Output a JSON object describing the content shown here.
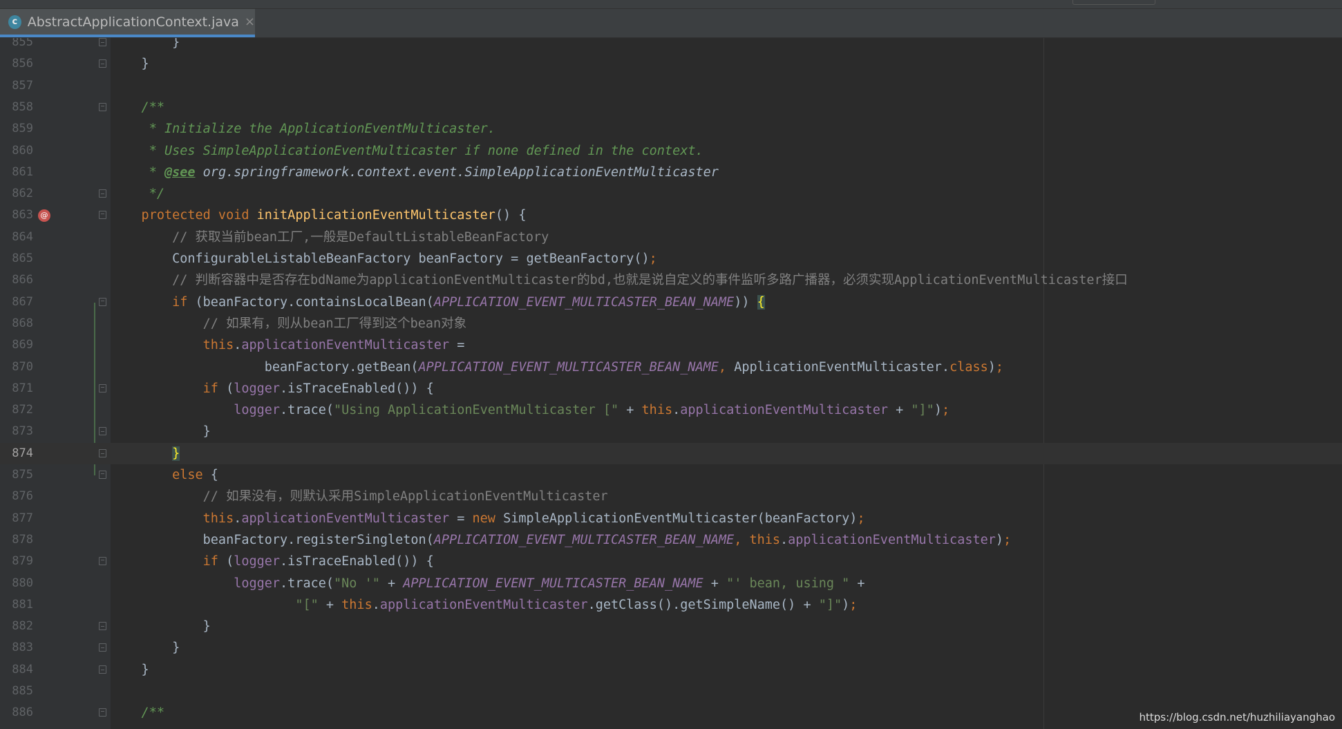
{
  "tab": {
    "icon": "c",
    "title": "AbstractApplicationContext.java",
    "close": "×"
  },
  "watermark": "https://blog.csdn.net/huzhiliayanghao",
  "lines": [
    {
      "n": "855",
      "fold": "end",
      "tokens": [
        [
          "",
          "        }"
        ]
      ]
    },
    {
      "n": "856",
      "fold": "end",
      "tokens": [
        [
          "",
          "    }"
        ]
      ]
    },
    {
      "n": "857",
      "tokens": []
    },
    {
      "n": "858",
      "fold": "start",
      "tokens": [
        [
          "jd",
          "    /**"
        ]
      ]
    },
    {
      "n": "859",
      "tokens": [
        [
          "jd",
          "     * Initialize the ApplicationEventMulticaster."
        ]
      ]
    },
    {
      "n": "860",
      "tokens": [
        [
          "jd",
          "     * Uses SimpleApplicationEventMulticaster if none defined in the context."
        ]
      ]
    },
    {
      "n": "861",
      "tokens": [
        [
          "jd",
          "     * "
        ],
        [
          "jdtag",
          "@see"
        ],
        [
          "jdref",
          " org.springframework.context.event.SimpleApplicationEventMulticaster"
        ]
      ]
    },
    {
      "n": "862",
      "fold": "end",
      "tokens": [
        [
          "jd",
          "     */"
        ]
      ]
    },
    {
      "n": "863",
      "fold": "start",
      "override": "@",
      "tokens": [
        [
          "k",
          "    protected void "
        ],
        [
          "f",
          "initApplicationEventMulticaster"
        ],
        [
          "",
          "() {"
        ]
      ]
    },
    {
      "n": "864",
      "tokens": [
        [
          "c",
          "        // 获取当前bean工厂,一般是DefaultListableBeanFactory"
        ]
      ]
    },
    {
      "n": "865",
      "tokens": [
        [
          "",
          "        ConfigurableListableBeanFactory beanFactory = getBeanFactory()"
        ],
        [
          "k",
          ";"
        ]
      ]
    },
    {
      "n": "866",
      "tokens": [
        [
          "c",
          "        // 判断容器中是否存在bdName为applicationEventMulticaster的bd,也就是说自定义的事件监听多路广播器，必须实现ApplicationEventMulticaster接口"
        ]
      ]
    },
    {
      "n": "867",
      "fold": "start",
      "tokens": [
        [
          "k",
          "        if "
        ],
        [
          "",
          "(beanFactory.containsLocalBean("
        ],
        [
          "cst",
          "APPLICATION_EVENT_MULTICASTER_BEAN_NAME"
        ],
        [
          "",
          ")) "
        ],
        [
          "brace-hl",
          "{"
        ]
      ]
    },
    {
      "n": "868",
      "tokens": [
        [
          "c",
          "            // 如果有，则从bean工厂得到这个bean对象"
        ]
      ]
    },
    {
      "n": "869",
      "tokens": [
        [
          "k",
          "            this"
        ],
        [
          "",
          "."
        ],
        [
          "fld",
          "applicationEventMulticaster"
        ],
        [
          "",
          " ="
        ]
      ]
    },
    {
      "n": "870",
      "tokens": [
        [
          "",
          "                    beanFactory.getBean("
        ],
        [
          "cst",
          "APPLICATION_EVENT_MULTICASTER_BEAN_NAME"
        ],
        [
          "k",
          ", "
        ],
        [
          "",
          "ApplicationEventMulticaster."
        ],
        [
          "k",
          "class"
        ],
        [
          "",
          ")"
        ],
        [
          "k",
          ";"
        ]
      ]
    },
    {
      "n": "871",
      "fold": "start",
      "tokens": [
        [
          "k",
          "            if "
        ],
        [
          "",
          "("
        ],
        [
          "fld",
          "logger"
        ],
        [
          "",
          ".isTraceEnabled()) {"
        ]
      ]
    },
    {
      "n": "872",
      "tokens": [
        [
          "",
          "                "
        ],
        [
          "fld",
          "logger"
        ],
        [
          "",
          ".trace("
        ],
        [
          "str",
          "\"Using ApplicationEventMulticaster [\""
        ],
        [
          "",
          " + "
        ],
        [
          "k",
          "this"
        ],
        [
          "",
          "."
        ],
        [
          "fld",
          "applicationEventMulticaster"
        ],
        [
          "",
          " + "
        ],
        [
          "str",
          "\"]\""
        ],
        [
          "",
          ")"
        ],
        [
          "k",
          ";"
        ]
      ]
    },
    {
      "n": "873",
      "fold": "end",
      "tokens": [
        [
          "",
          "            }"
        ]
      ]
    },
    {
      "n": "874",
      "fold": "end",
      "current": true,
      "tokens": [
        [
          "",
          "        "
        ],
        [
          "brace-hl",
          "}"
        ]
      ]
    },
    {
      "n": "875",
      "fold": "start",
      "tokens": [
        [
          "k",
          "        else "
        ],
        [
          "",
          "{"
        ]
      ]
    },
    {
      "n": "876",
      "tokens": [
        [
          "c",
          "            // 如果没有，则默认采用SimpleApplicationEventMulticaster"
        ]
      ]
    },
    {
      "n": "877",
      "tokens": [
        [
          "k",
          "            this"
        ],
        [
          "",
          "."
        ],
        [
          "fld",
          "applicationEventMulticaster"
        ],
        [
          "",
          " = "
        ],
        [
          "k",
          "new "
        ],
        [
          "",
          "SimpleApplicationEventMulticaster(beanFactory)"
        ],
        [
          "k",
          ";"
        ]
      ]
    },
    {
      "n": "878",
      "tokens": [
        [
          "",
          "            beanFactory.registerSingleton("
        ],
        [
          "cst",
          "APPLICATION_EVENT_MULTICASTER_BEAN_NAME"
        ],
        [
          "k",
          ", this"
        ],
        [
          "",
          "."
        ],
        [
          "fld",
          "applicationEventMulticaster"
        ],
        [
          "",
          ")"
        ],
        [
          "k",
          ";"
        ]
      ]
    },
    {
      "n": "879",
      "fold": "start",
      "tokens": [
        [
          "k",
          "            if "
        ],
        [
          "",
          "("
        ],
        [
          "fld",
          "logger"
        ],
        [
          "",
          ".isTraceEnabled()) {"
        ]
      ]
    },
    {
      "n": "880",
      "tokens": [
        [
          "",
          "                "
        ],
        [
          "fld",
          "logger"
        ],
        [
          "",
          ".trace("
        ],
        [
          "str",
          "\"No '\""
        ],
        [
          "",
          " + "
        ],
        [
          "cst",
          "APPLICATION_EVENT_MULTICASTER_BEAN_NAME"
        ],
        [
          "",
          " + "
        ],
        [
          "str",
          "\"' bean, using \""
        ],
        [
          "",
          " +"
        ]
      ]
    },
    {
      "n": "881",
      "tokens": [
        [
          "",
          "                        "
        ],
        [
          "str",
          "\"[\""
        ],
        [
          "",
          " + "
        ],
        [
          "k",
          "this"
        ],
        [
          "",
          "."
        ],
        [
          "fld",
          "applicationEventMulticaster"
        ],
        [
          "",
          ".getClass().getSimpleName() + "
        ],
        [
          "str",
          "\"]\""
        ],
        [
          "",
          ")"
        ],
        [
          "k",
          ";"
        ]
      ]
    },
    {
      "n": "882",
      "fold": "end",
      "tokens": [
        [
          "",
          "            }"
        ]
      ]
    },
    {
      "n": "883",
      "fold": "end",
      "tokens": [
        [
          "",
          "        }"
        ]
      ]
    },
    {
      "n": "884",
      "fold": "end",
      "tokens": [
        [
          "",
          "    }"
        ]
      ]
    },
    {
      "n": "885",
      "tokens": []
    },
    {
      "n": "886",
      "fold": "start",
      "tokens": [
        [
          "jd",
          "    /**"
        ]
      ]
    }
  ]
}
